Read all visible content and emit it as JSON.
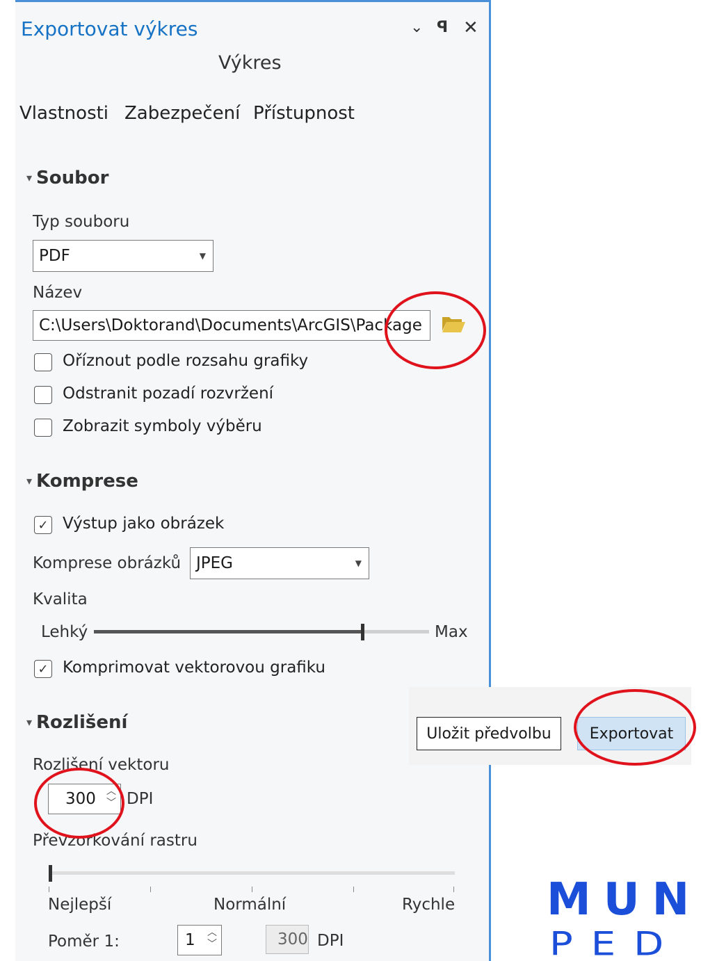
{
  "pane": {
    "title": "Exportovat výkres",
    "subtitle": "Výkres",
    "header_icons": [
      "chevron-down-icon",
      "pin-icon",
      "close-icon"
    ]
  },
  "tabs": [
    "Vlastnosti",
    "Zabezpečení",
    "Přístupnost"
  ],
  "file_section": {
    "heading": "Soubor",
    "file_type_label": "Typ souboru",
    "file_type_value": "PDF",
    "name_label": "Název",
    "name_value": "C:\\Users\\Doktorand\\Documents\\ArcGIS\\Package",
    "checkboxes": [
      {
        "label": "Oříznout podle rozsahu grafiky",
        "checked": false
      },
      {
        "label": "Odstranit pozadí rozvržení",
        "checked": false
      },
      {
        "label": "Zobrazit symboly výběru",
        "checked": false
      }
    ]
  },
  "compression_section": {
    "heading": "Komprese",
    "output_as_image_label": "Výstup jako obrázek",
    "output_as_image_checked": true,
    "image_compression_label": "Komprese obrázků",
    "image_compression_value": "JPEG",
    "quality_label": "Kvalita",
    "quality_min_label": "Lehký",
    "quality_max_label": "Max",
    "quality_level": 0.8,
    "compress_vector_label": "Komprimovat vektorovou grafiku",
    "compress_vector_checked": true
  },
  "resolution_section": {
    "heading": "Rozlišení",
    "vector_resolution_label": "Rozlišení vektoru",
    "vector_resolution_value": "300",
    "dpi_unit": "DPI",
    "raster_resampling_label": "Převzorkování rastru",
    "raster_level": 0,
    "raster_labels": [
      "Nejlepší",
      "Normální",
      "Rychle"
    ],
    "ratio_label": "Poměr 1:",
    "ratio_value": "1",
    "ratio_dpi_value": "300",
    "ratio_dpi_unit": "DPI"
  },
  "buttons": {
    "save_preset": "Uložit předvolbu",
    "export": "Exportovat"
  },
  "logo": {
    "line1": "MUNI",
    "line2": "PED"
  },
  "colors": {
    "accent": "#1672c4",
    "highlight": "#e0121c",
    "logo": "#1b4fd9",
    "export_button_bg": "#cfe3f5"
  }
}
